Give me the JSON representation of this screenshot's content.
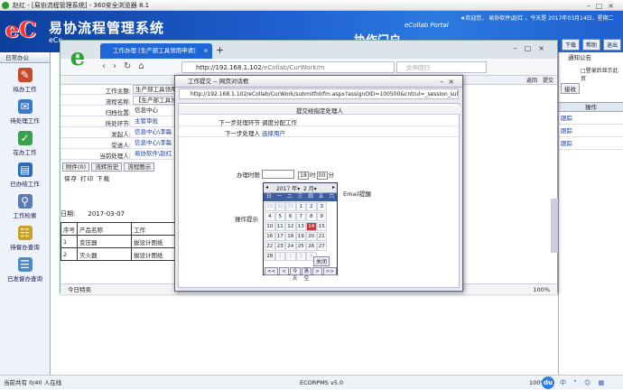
{
  "window": {
    "title": "赵红 - [易协流程管理系统] - 360安全浏览器 8.1"
  },
  "banner": {
    "ec": "eC",
    "system_name": "易协流程管理系统",
    "ec_small": "eCo",
    "portal": "协作门户",
    "portal_en": "eCollab Portal",
    "welcome": "★欢迎您，  易协软件\\赵红 ，今天是  2017年03月14日，星期二",
    "btn_download": "下载",
    "btn_help": "帮助",
    "btn_exit": "退出"
  },
  "leftnav": {
    "header": "日常办公",
    "items": [
      "拟办工作",
      "待处理工作",
      "在办工作",
      "已办结工作",
      "工作检索",
      "待督办查询",
      "已发督办查询"
    ]
  },
  "rightpanel": {
    "notice": "通知公告",
    "checkbox": "□登录后显示此页",
    "op_header": "操作",
    "ops": [
      "跟踪",
      "跟踪",
      "跟踪"
    ],
    "recv_btn": "接收"
  },
  "browser2": {
    "tab": "工作办理 [生产部工具领用申请]",
    "url_host": "http://192.168.1.102",
    "url_rest": "/eCollab/CurWork/m",
    "search_placeholder": "女神回归",
    "back_btn": "返回",
    "submit_btn": "提交"
  },
  "form": {
    "rows": [
      {
        "label": "工作主题:",
        "value": "生产部工具领用"
      },
      {
        "label": "流程名称:",
        "value": "【生产部工具领"
      },
      {
        "label": "归档位置:",
        "value": "信息中心"
      },
      {
        "label": "所处环节:",
        "value": "主管审批"
      },
      {
        "label": "发起人:",
        "value": "信息中心\\李磊"
      },
      {
        "label": "受送人:",
        "value": "信息中心\\李磊"
      },
      {
        "label": "当前处理人:",
        "value": "易协软件\\赵红"
      }
    ],
    "buttons": [
      "附件(0)",
      "流转历史",
      "流程图示"
    ],
    "toolbar": "保存 打印 下载",
    "date_label": "日期:",
    "date_value": "2017-03-07",
    "table": {
      "headers": [
        "序号",
        "产品名称",
        "工作"
      ],
      "rows": [
        [
          "1",
          "变压器",
          "拔设计图纸"
        ],
        [
          "2",
          "灭火器",
          "拔设计图纸"
        ]
      ]
    },
    "status_left": "今日特卖",
    "status_zoom": "100%"
  },
  "dialog": {
    "title": "工作提交 -- 网页对话框",
    "url": "http://192.168.1.102/eCollab/CurWork/submitfolrfm.aspx?assignOID=100500&cntrul=_session_sul",
    "header": "提交给指定处理人",
    "next_step_label": "下一步处理环节",
    "next_step_value": "调度分配工作",
    "next_person_label": "下一步处理人",
    "next_person_value": "选择用户",
    "deadline_label": "办理时限",
    "hour": "18",
    "hour_unit": "时",
    "minute": "00",
    "minute_unit": "分",
    "email": "Email提醒",
    "op_label": "操作提示",
    "cal": {
      "year": "2017",
      "year_unit": "年",
      "month": "2",
      "month_unit": "月",
      "weekdays": [
        "日",
        "一",
        "二",
        "三",
        "四",
        "五",
        "六"
      ],
      "days": [
        "29",
        "30",
        "31",
        "1",
        "2",
        "3",
        "4",
        "5",
        "6",
        "7",
        "8",
        "9",
        "10",
        "11",
        "12",
        "13",
        "14",
        "15",
        "16",
        "17",
        "18",
        "19",
        "20",
        "21",
        "22",
        "23",
        "24",
        "25",
        "26",
        "27",
        "28",
        "1",
        "2",
        "3",
        "4"
      ],
      "close": "关闭",
      "footer": [
        "<<",
        "<",
        "今天",
        "清空",
        ">",
        ">>"
      ]
    }
  },
  "taskbar": {
    "left": "当前共有 0/40 人在线",
    "center": "ECORPMS v5.0",
    "right": "100%",
    "du": "du",
    "tray": "中 ° ☺ ▦"
  }
}
